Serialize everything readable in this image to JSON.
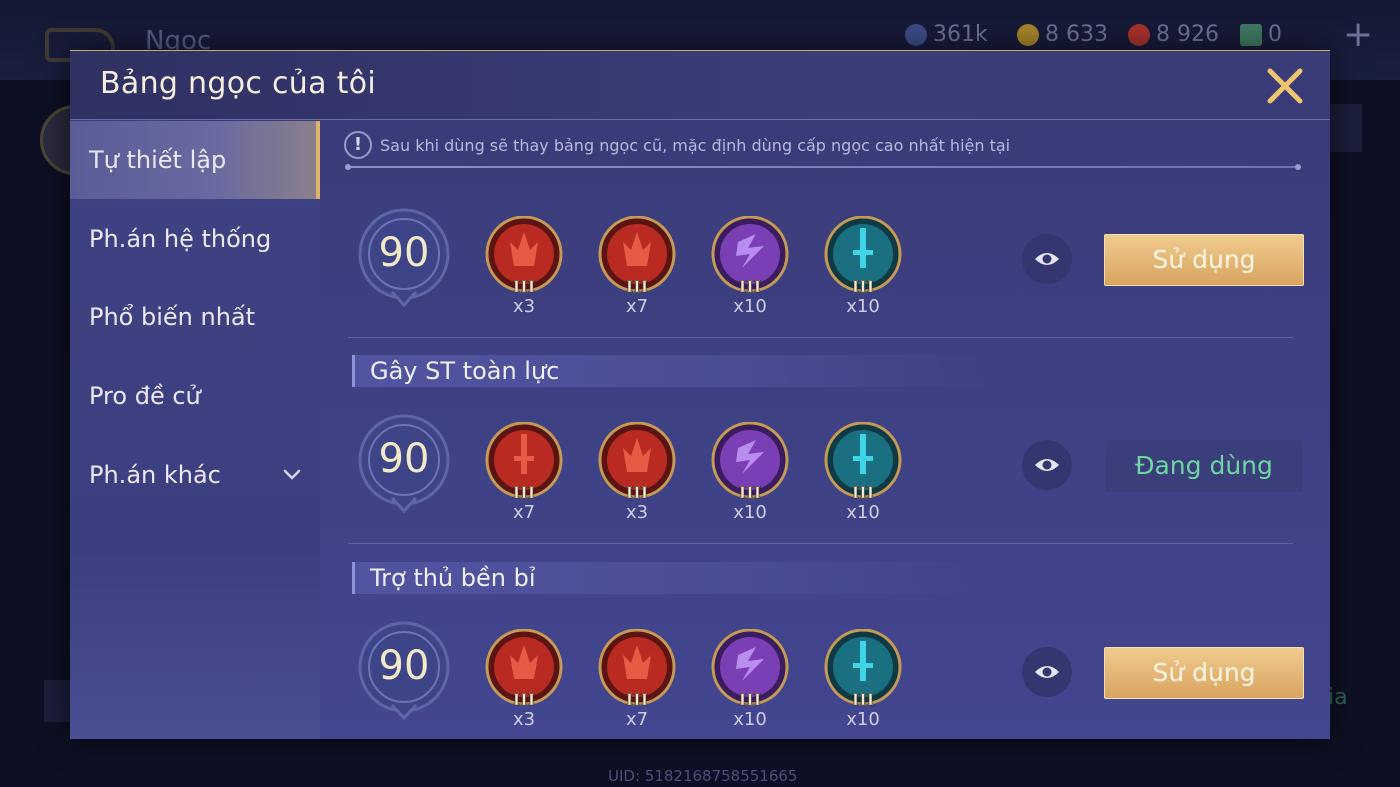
{
  "background": {
    "title": "Ngọc",
    "resources": [
      {
        "name": "dust",
        "value": "361k",
        "color": "#3b4b86"
      },
      {
        "name": "gold-coin",
        "value": "8 633",
        "color": "#a8842a"
      },
      {
        "name": "red-gem",
        "value": "8 926",
        "color": "#a8322e"
      },
      {
        "name": "card",
        "value": "0",
        "color": "#3f7a62"
      }
    ],
    "plus": "+",
    "uid": "UID: 5182168758551665",
    "right_text": "ia"
  },
  "modal": {
    "title": "Bảng ngọc của tôi",
    "close": "✕"
  },
  "sidebar": {
    "items": [
      {
        "label": "Tự thiết lập",
        "active": true
      },
      {
        "label": "Ph.án hệ thống",
        "active": false
      },
      {
        "label": "Phổ biến nhất",
        "active": false
      },
      {
        "label": "Pro đề cử",
        "active": false
      },
      {
        "label": "Ph.án khác",
        "active": false,
        "expandable": true
      }
    ]
  },
  "notice": {
    "icon": "!",
    "text": "Sau khi dùng sẽ thay bảng ngọc cũ, mặc định dùng cấp ngọc cao nhất hiện tại"
  },
  "sets": [
    {
      "group_title": "",
      "level": "90",
      "gems": [
        {
          "type": "red-claw",
          "tier": "III",
          "count": "x3"
        },
        {
          "type": "red-claw",
          "tier": "III",
          "count": "x7"
        },
        {
          "type": "purple-lightning",
          "tier": "III",
          "count": "x10"
        },
        {
          "type": "teal-sword",
          "tier": "III",
          "count": "x10"
        }
      ],
      "action": "Sử dụng",
      "in_use": false
    },
    {
      "group_title": "Gây ST toàn lực",
      "level": "90",
      "gems": [
        {
          "type": "red-sword",
          "tier": "III",
          "count": "x7"
        },
        {
          "type": "red-claw",
          "tier": "III",
          "count": "x3"
        },
        {
          "type": "purple-lightning",
          "tier": "III",
          "count": "x10"
        },
        {
          "type": "teal-sword",
          "tier": "III",
          "count": "x10"
        }
      ],
      "action": "Đang dùng",
      "in_use": true
    },
    {
      "group_title": "Trợ thủ bền bỉ",
      "level": "90",
      "gems": [
        {
          "type": "red-claw",
          "tier": "III",
          "count": "x3"
        },
        {
          "type": "red-claw",
          "tier": "III",
          "count": "x7"
        },
        {
          "type": "purple-lightning",
          "tier": "III",
          "count": "x10"
        },
        {
          "type": "teal-sword",
          "tier": "III",
          "count": "x10"
        }
      ],
      "action": "Sử dụng",
      "in_use": false
    }
  ]
}
